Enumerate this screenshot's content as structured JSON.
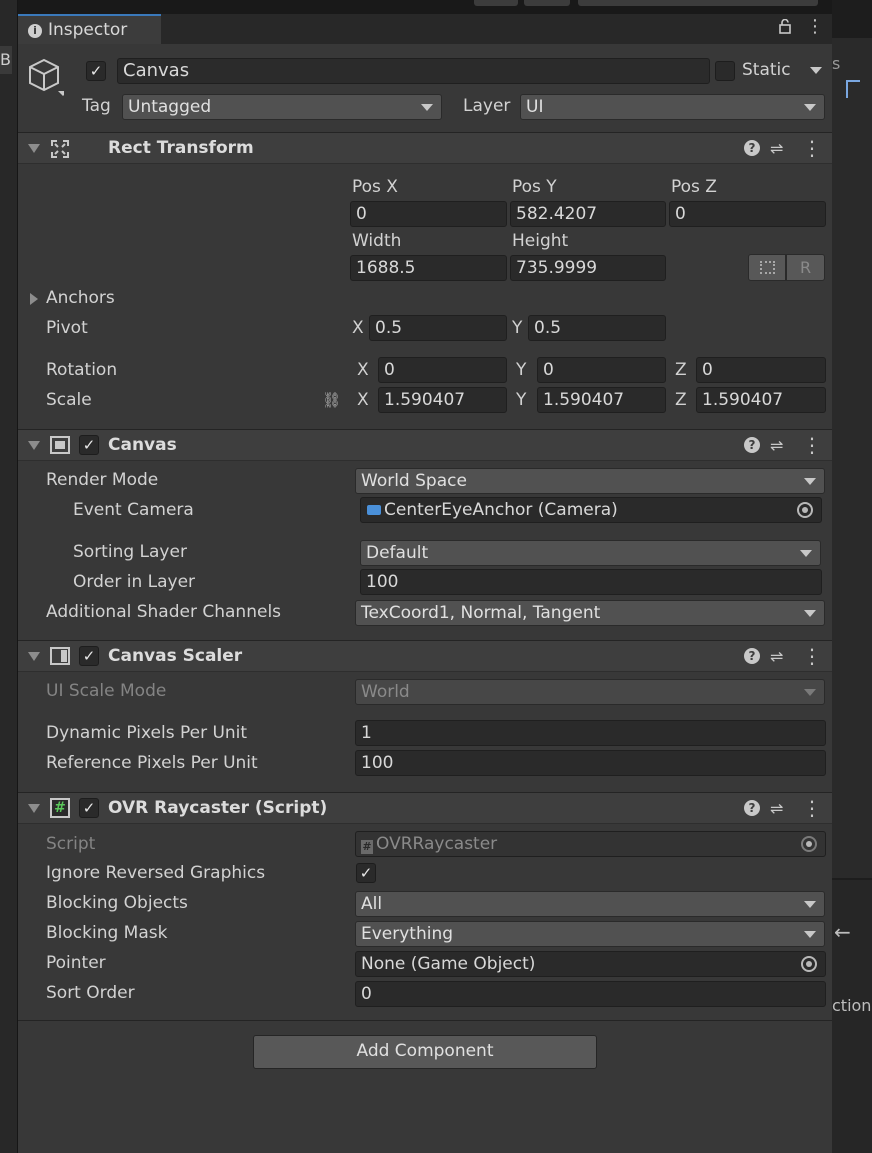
{
  "left_edge_text": "B",
  "tab": {
    "title": "Inspector"
  },
  "object": {
    "name": "Canvas",
    "static_label": "Static",
    "tag_label": "Tag",
    "tag_value": "Untagged",
    "layer_label": "Layer",
    "layer_value": "UI"
  },
  "rect_transform": {
    "title": "Rect Transform",
    "pos_x_label": "Pos X",
    "pos_y_label": "Pos Y",
    "pos_z_label": "Pos Z",
    "pos_x": "0",
    "pos_y": "582.4207",
    "pos_z": "0",
    "width_label": "Width",
    "height_label": "Height",
    "width": "1688.5",
    "height": "735.9999",
    "r_label": "R",
    "anchors_label": "Anchors",
    "pivot_label": "Pivot",
    "pivot_x": "0.5",
    "pivot_y": "0.5",
    "rotation_label": "Rotation",
    "rot_x": "0",
    "rot_y": "0",
    "rot_z": "0",
    "scale_label": "Scale",
    "scale_x": "1.590407",
    "scale_y": "1.590407",
    "scale_z": "1.590407",
    "x": "X",
    "y": "Y",
    "z": "Z"
  },
  "canvas": {
    "title": "Canvas",
    "render_mode_label": "Render Mode",
    "render_mode": "World Space",
    "event_camera_label": "Event Camera",
    "event_camera": "CenterEyeAnchor (Camera)",
    "sorting_layer_label": "Sorting Layer",
    "sorting_layer": "Default",
    "order_label": "Order in Layer",
    "order": "100",
    "shader_label": "Additional Shader Channels",
    "shader": "TexCoord1, Normal, Tangent"
  },
  "canvas_scaler": {
    "title": "Canvas Scaler",
    "ui_scale_label": "UI Scale Mode",
    "ui_scale": "World",
    "dynamic_label": "Dynamic Pixels Per Unit",
    "dynamic": "1",
    "reference_label": "Reference Pixels Per Unit",
    "reference": "100"
  },
  "ovr_raycaster": {
    "title": "OVR Raycaster (Script)",
    "script_label": "Script",
    "script": "OVRRaycaster",
    "ignore_label": "Ignore Reversed Graphics",
    "blocking_objects_label": "Blocking Objects",
    "blocking_objects": "All",
    "blocking_mask_label": "Blocking Mask",
    "blocking_mask": "Everything",
    "pointer_label": "Pointer",
    "pointer": "None (Game Object)",
    "sort_order_label": "Sort Order",
    "sort_order": "0"
  },
  "add_component": "Add Component",
  "right_edge_text": "ction",
  "right_edge_text2": "s"
}
